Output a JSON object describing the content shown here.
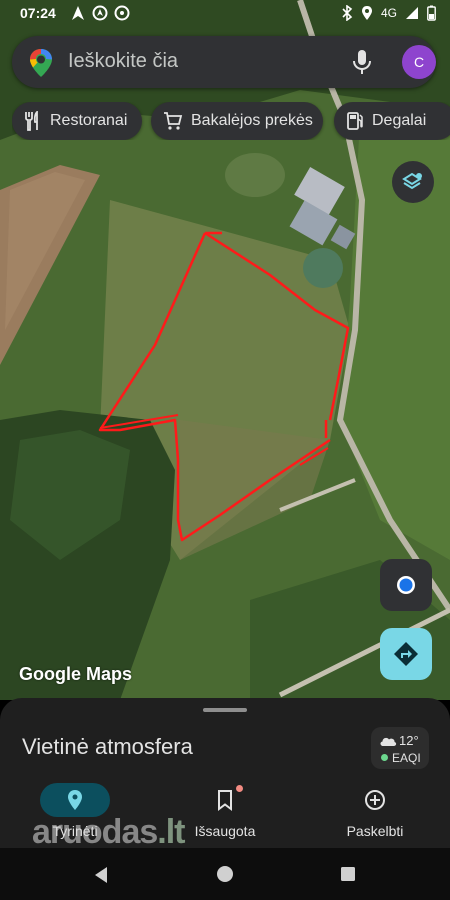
{
  "status_bar": {
    "time": "07:24",
    "network": "4G"
  },
  "search": {
    "placeholder": "Ieškokite čia",
    "avatar_letter": "C"
  },
  "chips": [
    {
      "label": "Restoranai",
      "icon": "fork-knife-icon"
    },
    {
      "label": "Bakalėjos prekės",
      "icon": "cart-icon"
    },
    {
      "label": "Degalai",
      "icon": "gas-pump-icon"
    }
  ],
  "map": {
    "logo": "Google Maps"
  },
  "sheet": {
    "title": "Vietinė atmosfera"
  },
  "weather": {
    "temp": "12°",
    "aqi": "EAQI"
  },
  "bottom_nav": [
    {
      "label": "Tyrinėti",
      "icon": "location-pin-icon",
      "active": true
    },
    {
      "label": "Išsaugota",
      "icon": "bookmark-icon",
      "active": false
    },
    {
      "label": "Paskelbti",
      "icon": "plus-circle-icon",
      "active": false
    }
  ],
  "watermark": {
    "main": "aruodas",
    "suffix": ".lt"
  },
  "colors": {
    "accent": "#79d7e6",
    "surface": "#303134",
    "outline_red": "#ff1a1a",
    "nav_active": "#0c4f5e"
  }
}
